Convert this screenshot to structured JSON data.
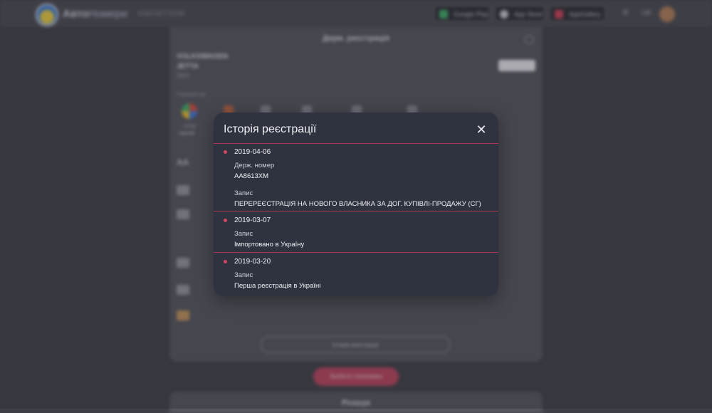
{
  "header": {
    "brand_bold": "Авто",
    "brand_light": "Номери",
    "cabinet": "КАБІНЕТ/ЗОМ",
    "stores": [
      "Google Play",
      "App Store",
      "AppGallery"
    ],
    "lang": "UK"
  },
  "card": {
    "title": "Держ. реєстрація",
    "make": "VOLKSWAGEN",
    "model": "JETTA",
    "year": "2013",
    "params_label": "Параметри",
    "color_caption": "Колір",
    "color_value": "чорний",
    "history_button": "Історія реєстрації"
  },
  "share_button": "Зробити строковану",
  "card2_title": "Розшук",
  "modal": {
    "title": "Історія реєстрації",
    "close_icon": "close-icon",
    "entries": [
      {
        "date": "2019-04-06",
        "plate_label": "Держ. номер",
        "plate": "АА8613ХМ",
        "record_label": "Запис",
        "record": "ПЕРЕРЕЄСТРАЦІЯ НА НОВОГО ВЛАСНИКА ЗА ДОГ. КУПІВЛІ-ПРОДАЖУ (СГ)"
      },
      {
        "date": "2019-03-07",
        "record_label": "Запис",
        "record": "Імпортовано в Україну"
      },
      {
        "date": "2019-03-20",
        "record_label": "Запис",
        "record": "Перша реєстрація в Україні"
      }
    ]
  },
  "colors": {
    "accent": "#d24561",
    "modal_bg": "#2f323f",
    "page_bg": "#3f4047"
  }
}
